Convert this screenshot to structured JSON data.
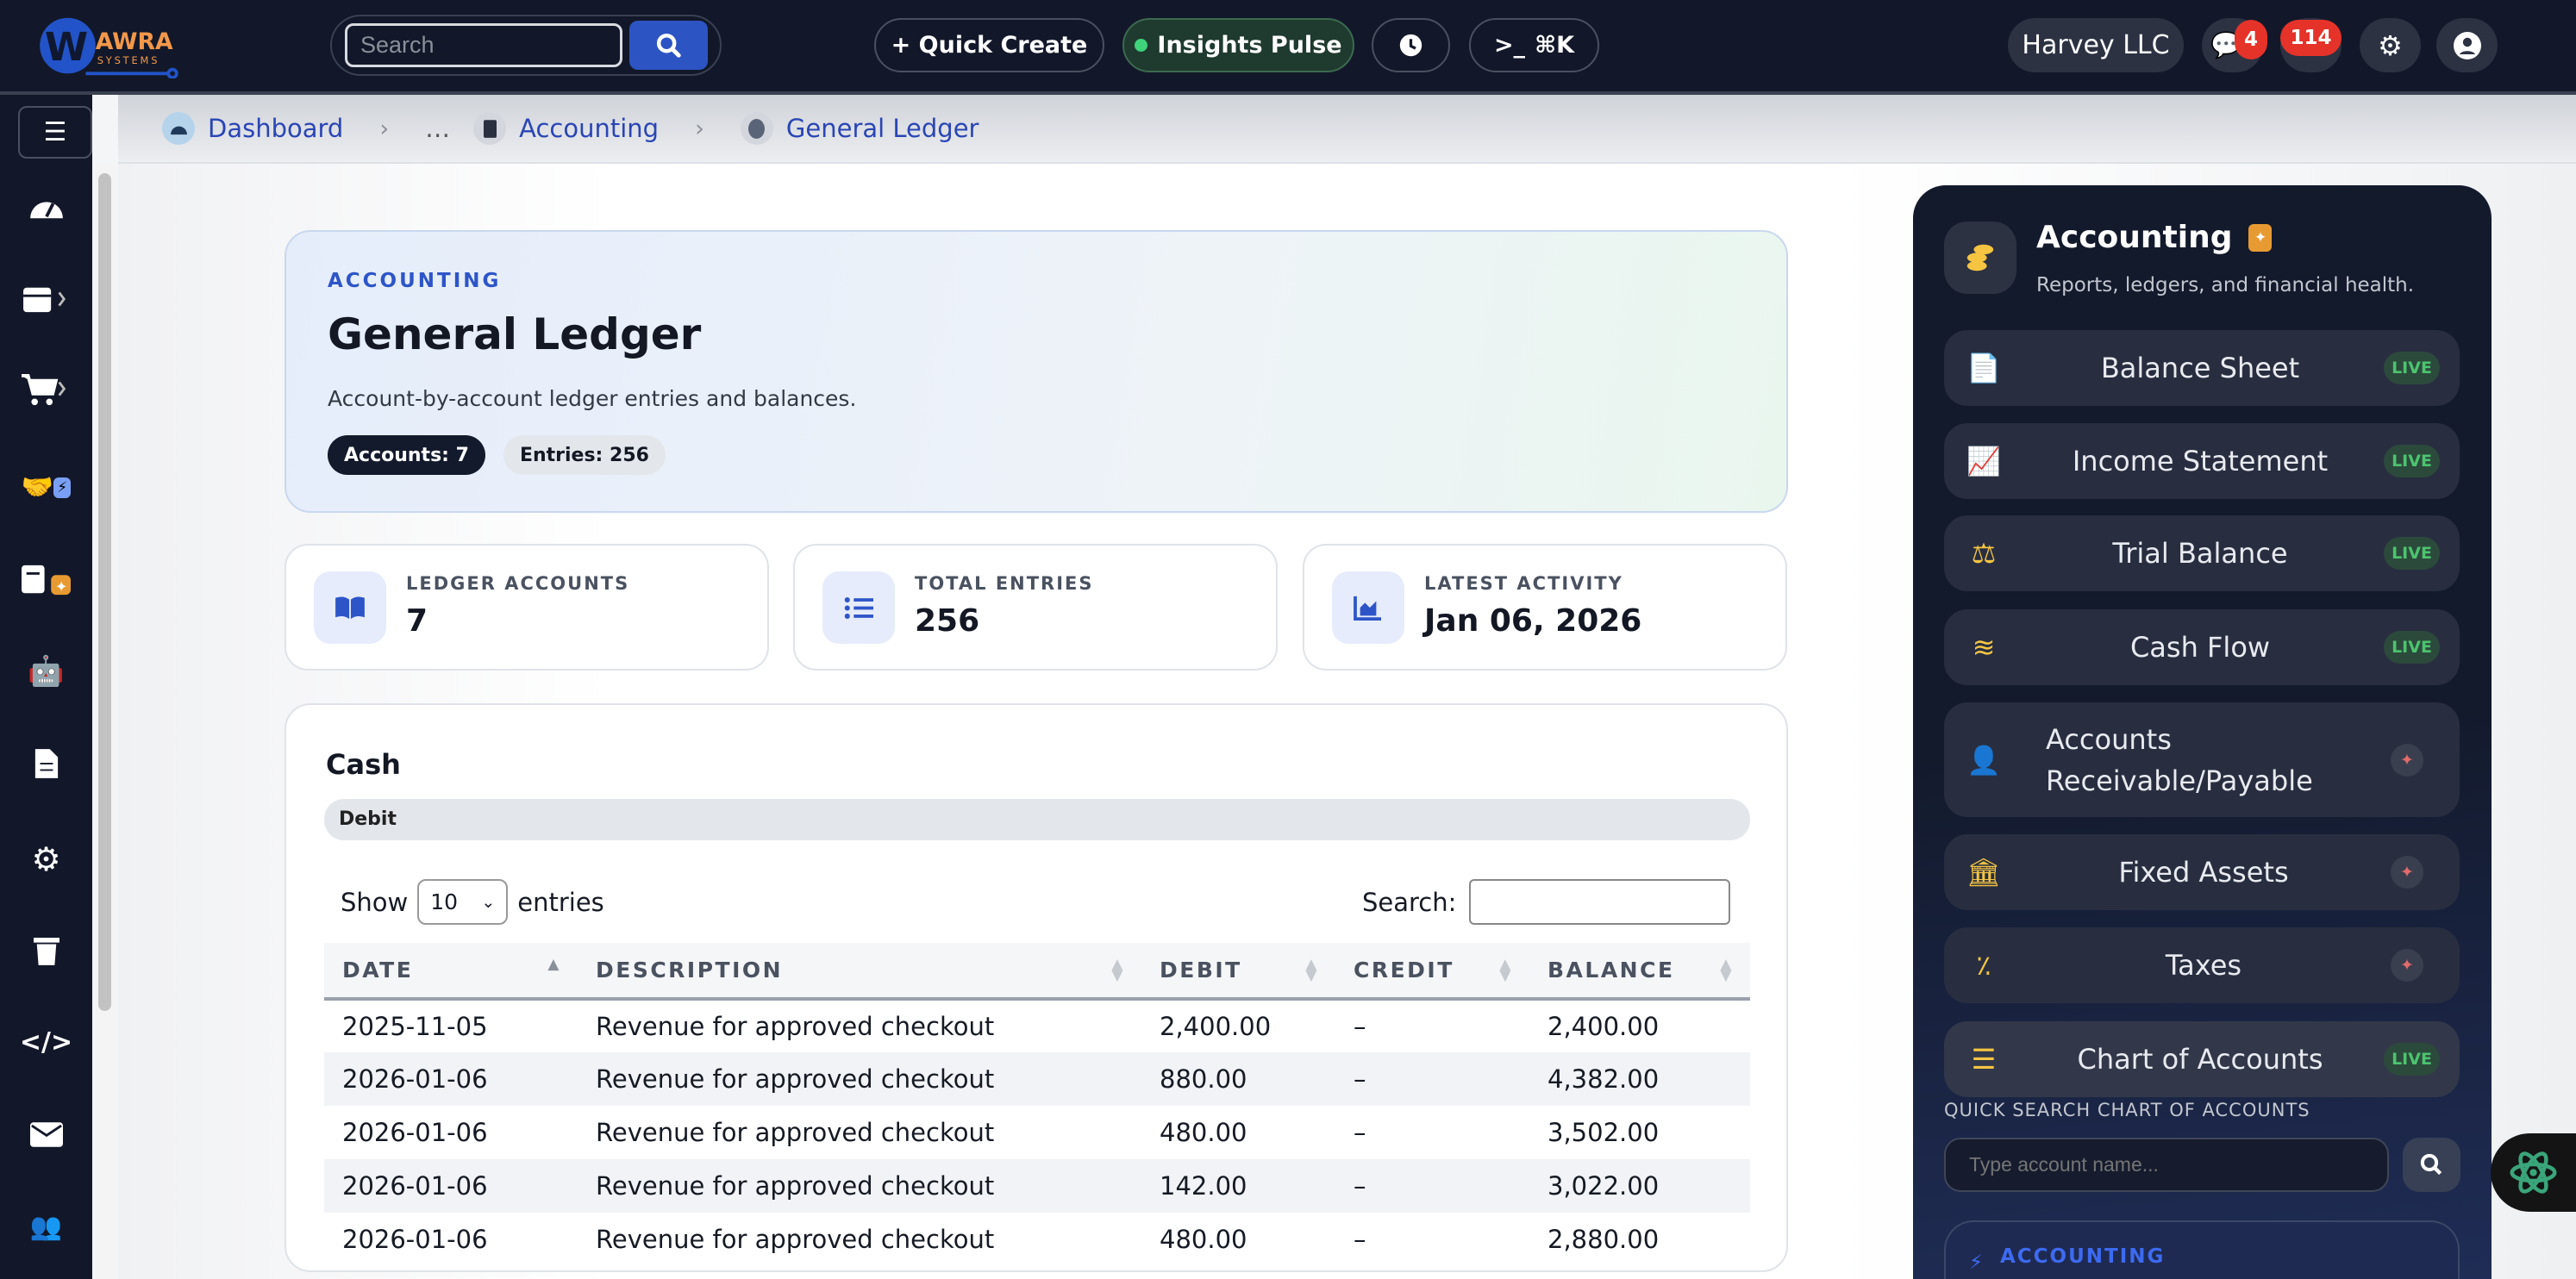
{
  "header": {
    "logo_text": "AWRA SYSTEMS",
    "search_placeholder": "Search",
    "quick_create": "+ Quick Create",
    "insights": "Insights Pulse",
    "shortcut": "⌘K",
    "company": "Harvey LLC",
    "messages_count": "4",
    "notifications_count": "114"
  },
  "breadcrumb": {
    "items": [
      "Dashboard",
      "…",
      "Accounting",
      "General Ledger"
    ]
  },
  "hero": {
    "kicker": "ACCOUNTING",
    "title": "General Ledger",
    "subtitle": "Account-by-account ledger entries and balances.",
    "chip_accounts": "Accounts: 7",
    "chip_entries": "Entries: 256"
  },
  "stats": [
    {
      "label": "LEDGER ACCOUNTS",
      "value": "7"
    },
    {
      "label": "TOTAL ENTRIES",
      "value": "256"
    },
    {
      "label": "LATEST ACTIVITY",
      "value": "Jan 06, 2026"
    }
  ],
  "ledger": {
    "account": "Cash",
    "type": "Debit",
    "show": "Show",
    "entries_value": "10",
    "entries": "entries",
    "search_label": "Search:",
    "columns": [
      "DATE",
      "DESCRIPTION",
      "DEBIT",
      "CREDIT",
      "BALANCE"
    ],
    "rows": [
      [
        "2025-11-05",
        "Revenue for approved checkout",
        "2,400.00",
        "–",
        "2,400.00"
      ],
      [
        "2026-01-06",
        "Revenue for approved checkout",
        "880.00",
        "–",
        "4,382.00"
      ],
      [
        "2026-01-06",
        "Revenue for approved checkout",
        "480.00",
        "–",
        "3,502.00"
      ],
      [
        "2026-01-06",
        "Revenue for approved checkout",
        "142.00",
        "–",
        "3,022.00"
      ],
      [
        "2026-01-06",
        "Revenue for approved checkout",
        "480.00",
        "–",
        "2,880.00"
      ]
    ]
  },
  "panel": {
    "title": "Accounting",
    "subtitle": "Reports, ledgers, and financial health.",
    "items": [
      {
        "label": "Balance Sheet",
        "status": "LIVE"
      },
      {
        "label": "Income Statement",
        "status": "LIVE"
      },
      {
        "label": "Trial Balance",
        "status": "LIVE"
      },
      {
        "label": "Cash Flow",
        "status": "LIVE"
      },
      {
        "label": "Accounts Receivable/Payable",
        "status": "✦"
      },
      {
        "label": "Fixed Assets",
        "status": "✦"
      },
      {
        "label": "Taxes",
        "status": "✦"
      },
      {
        "label": "Chart of Accounts",
        "status": "LIVE"
      }
    ],
    "quick_search_label": "QUICK SEARCH CHART OF ACCOUNTS",
    "quick_search_placeholder": "Type account name...",
    "footer_kicker": "ACCOUNTING"
  },
  "colors": {
    "header_bg": "#121829",
    "accent": "#2c54c3",
    "live": "#4cc46f",
    "badge": "#e5332a",
    "icon_yellow": "#f5c542"
  }
}
